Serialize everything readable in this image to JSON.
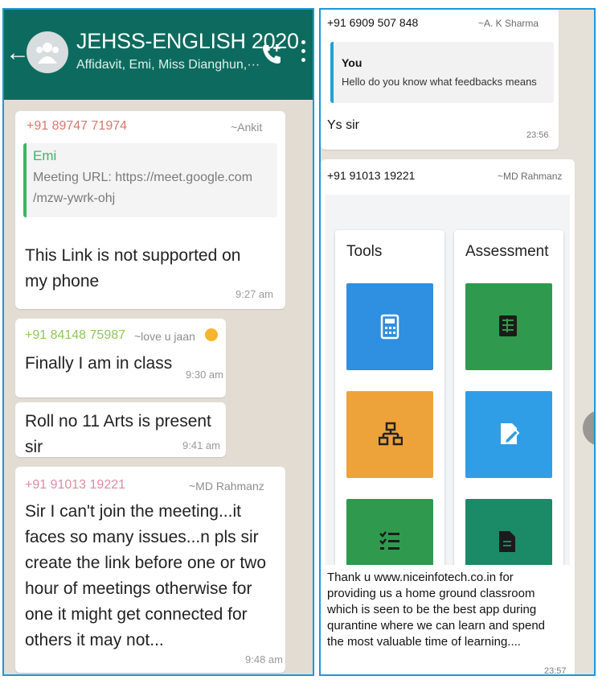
{
  "header": {
    "title": "JEHSS-ENGLISH 2020",
    "subtitle": "Affidavit, Emi, Miss Dianghun,···"
  },
  "left_messages": [
    {
      "sender": "+91 89747 71974",
      "alias": "~Ankit",
      "sender_color": "#d8776c",
      "quote": {
        "name": "Emi",
        "text": "Meeting URL: https://meet.google.com /mzw-ywrk-ohj"
      },
      "text": "This Link is not supported on my phone",
      "time": "9:27 am"
    },
    {
      "sender": "+91 84148 75987",
      "alias": "~love u jaan",
      "sender_color": "#8fc65a",
      "text": "Finally I am in class",
      "time": "9:30 am"
    },
    {
      "text": "Roll no 11 Arts is present sir",
      "time": "9:41 am"
    },
    {
      "sender": "+91 91013 19221",
      "alias": "~MD Rahmanz",
      "sender_color": "#e08aa4",
      "text": "Sir I can't join the meeting...it faces so many issues...n pls sir create the link before one or two hour of meetings otherwise for one it might get connected for others it may not...",
      "time": "9:48 am"
    }
  ],
  "right_messages": [
    {
      "sender": "+91 6909 507 848",
      "alias": "~A. K Sharma",
      "quote": {
        "name": "You",
        "text": "Hello do you know what feedbacks means"
      },
      "text": "Ys sir",
      "time": "23:56"
    },
    {
      "sender": "+91 91013 19221",
      "alias": "~MD Rahmanz",
      "image": {
        "cards": [
          "Tools",
          "Assessment"
        ],
        "colors": {
          "blue": "#2f8fe0",
          "green": "#2f9a4e",
          "orange": "#eea33a",
          "light_blue": "#2f9ee6",
          "teal": "#1b8a66"
        },
        "icons": [
          "calculator-icon",
          "spreadsheet-icon",
          "sitemap-icon",
          "pen-document-icon",
          "checklist-icon",
          "document-icon"
        ]
      },
      "text": "Thank u www.niceinfotech.co.in for providing us a home ground classroom which is seen to be the best app during qurantine where we can learn and spend the most valuable time of learning....",
      "time": "23:57"
    }
  ],
  "colors": {
    "header": "#0c6b5e",
    "chat_bg_left": "#e3dcd3",
    "chat_bg_right": "#e6e1d8",
    "panel_border": "#2196d8"
  }
}
